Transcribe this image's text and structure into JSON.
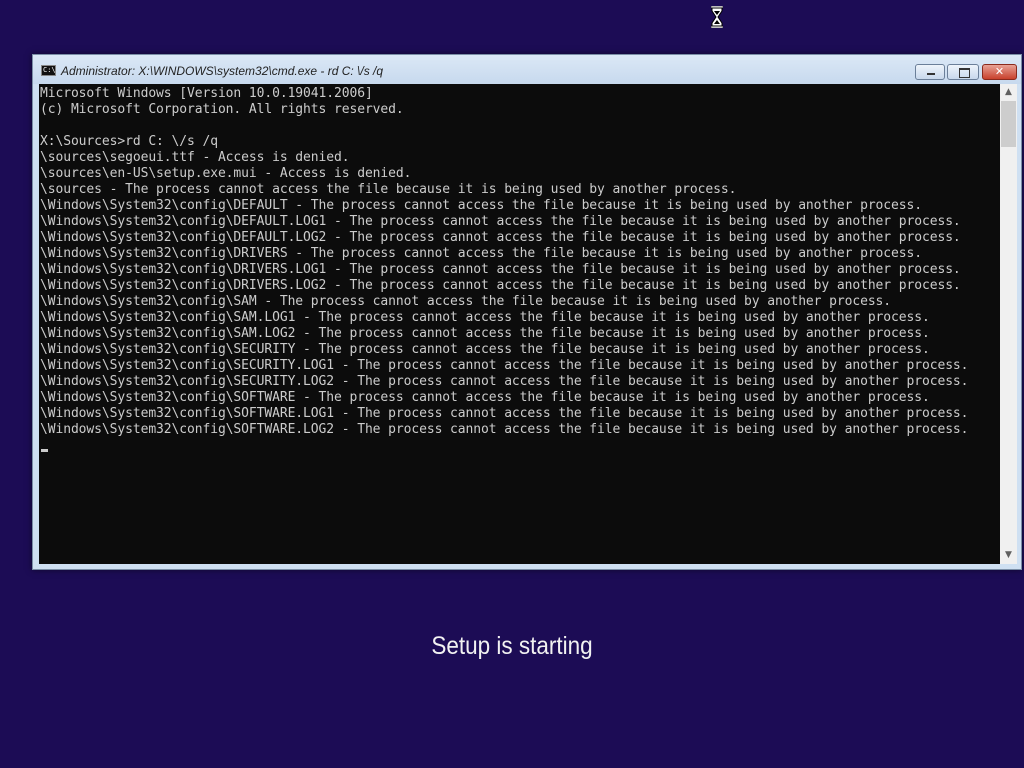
{
  "window": {
    "title": "Administrator: X:\\WINDOWS\\system32\\cmd.exe - rd  C: \\/s /q",
    "icon_label": "C:\\",
    "controls": {
      "minimize": "minimize-icon",
      "maximize": "maximize-icon",
      "close": "✕"
    }
  },
  "console": {
    "lines": [
      "Microsoft Windows [Version 10.0.19041.2006]",
      "(c) Microsoft Corporation. All rights reserved.",
      "",
      "X:\\Sources>rd C: \\/s /q",
      "\\sources\\segoeui.ttf - Access is denied.",
      "\\sources\\en-US\\setup.exe.mui - Access is denied.",
      "\\sources - The process cannot access the file because it is being used by another process.",
      "\\Windows\\System32\\config\\DEFAULT - The process cannot access the file because it is being used by another process.",
      "\\Windows\\System32\\config\\DEFAULT.LOG1 - The process cannot access the file because it is being used by another process.",
      "\\Windows\\System32\\config\\DEFAULT.LOG2 - The process cannot access the file because it is being used by another process.",
      "\\Windows\\System32\\config\\DRIVERS - The process cannot access the file because it is being used by another process.",
      "\\Windows\\System32\\config\\DRIVERS.LOG1 - The process cannot access the file because it is being used by another process.",
      "\\Windows\\System32\\config\\DRIVERS.LOG2 - The process cannot access the file because it is being used by another process.",
      "\\Windows\\System32\\config\\SAM - The process cannot access the file because it is being used by another process.",
      "\\Windows\\System32\\config\\SAM.LOG1 - The process cannot access the file because it is being used by another process.",
      "\\Windows\\System32\\config\\SAM.LOG2 - The process cannot access the file because it is being used by another process.",
      "\\Windows\\System32\\config\\SECURITY - The process cannot access the file because it is being used by another process.",
      "\\Windows\\System32\\config\\SECURITY.LOG1 - The process cannot access the file because it is being used by another process.",
      "\\Windows\\System32\\config\\SECURITY.LOG2 - The process cannot access the file because it is being used by another process.",
      "\\Windows\\System32\\config\\SOFTWARE - The process cannot access the file because it is being used by another process.",
      "\\Windows\\System32\\config\\SOFTWARE.LOG1 - The process cannot access the file because it is being used by another process.",
      "\\Windows\\System32\\config\\SOFTWARE.LOG2 - The process cannot access the file because it is being used by another process."
    ]
  },
  "scrollbar": {
    "up_arrow": "▲",
    "down_arrow": "▼"
  },
  "setup": {
    "status_text": "Setup is starting"
  },
  "cursor_icon": "hourglass-icon",
  "colors": {
    "desktop_background": "#1c0c55",
    "console_background": "#0c0c0c",
    "console_text": "#cccccc",
    "close_button": "#c8412c"
  }
}
